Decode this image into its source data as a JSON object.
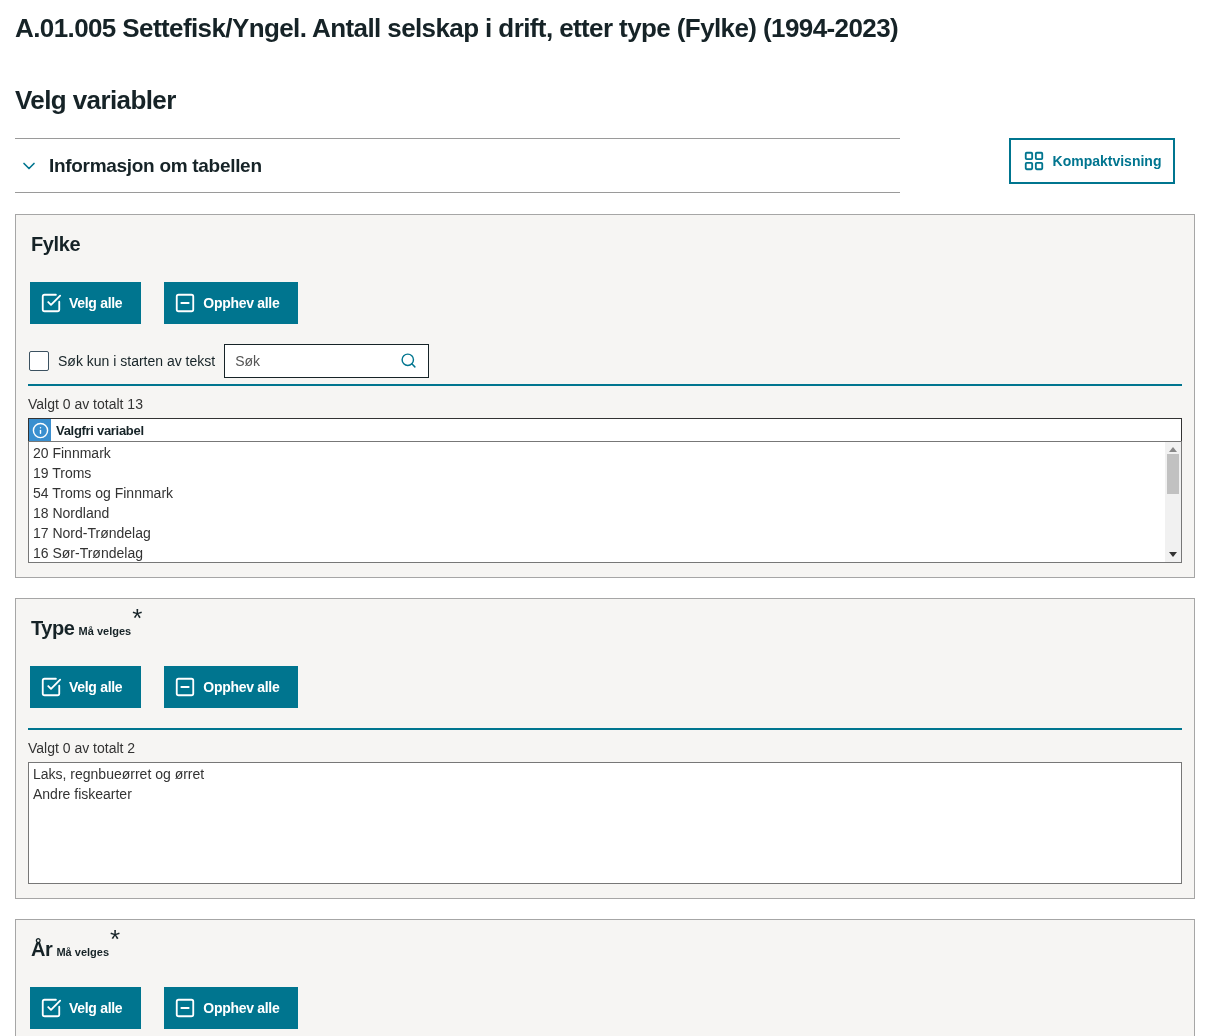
{
  "title": "A.01.005 Settefisk/Yngel. Antall selskap i drift, etter type (Fylke) (1994-2023)",
  "subtitle": "Velg variabler",
  "info": {
    "label": "Informasjon om tabellen",
    "expanded": false
  },
  "compact_button": "Kompaktvisning",
  "panels": [
    {
      "title": "Fylke",
      "buttons": [
        "Velg alle",
        "Opphev alle"
      ],
      "search": {
        "checkbox_label": "Søk kun i starten av tekst",
        "checked": false,
        "placeholder": "Søk"
      },
      "count": "Valgt 0 av totalt 13",
      "list_header": "Valgfri variabel",
      "scrollable": true,
      "items": [
        "20 Finnmark",
        "19 Troms",
        "54 Troms og Finnmark",
        "18 Nordland",
        "17 Nord-Trøndelag",
        "16 Sør-Trøndelag"
      ]
    },
    {
      "title": "Type",
      "required_label": "Må velges",
      "required_mark": "*",
      "buttons": [
        "Velg alle",
        "Opphev alle"
      ],
      "count": "Valgt 0 av totalt 2",
      "scrollable": false,
      "items": [
        "Laks, regnbueørret og ørret",
        "Andre fiskearter"
      ]
    },
    {
      "title": "År",
      "required_label": "Må velges",
      "required_mark": "*",
      "buttons": [
        "Velg alle",
        "Opphev alle"
      ]
    }
  ]
}
